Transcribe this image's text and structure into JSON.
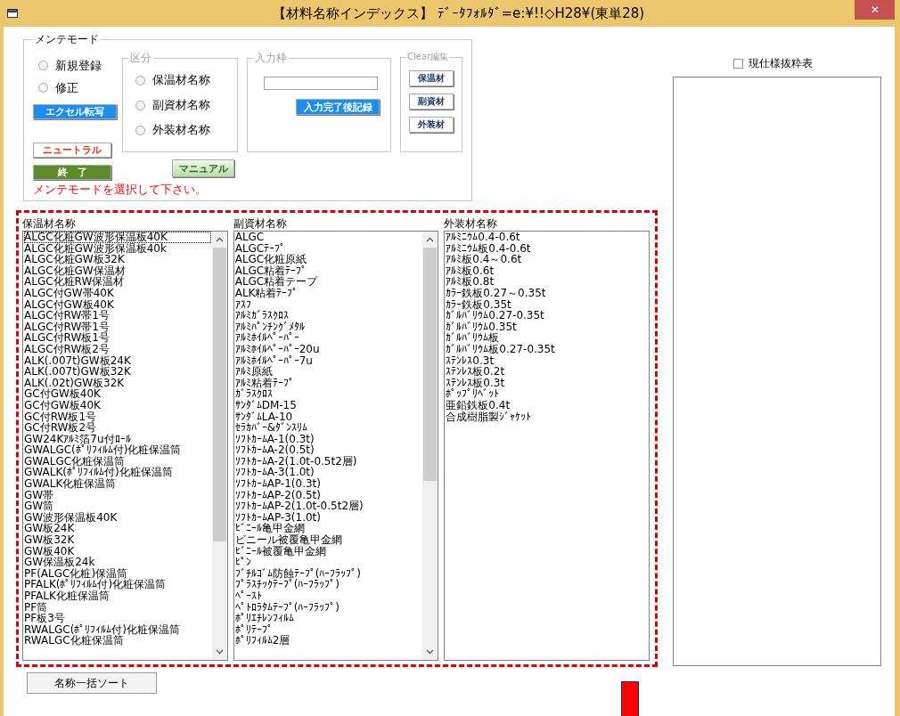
{
  "title_bar": {
    "title": "【材料名称インデックス】 ﾃﾞｰﾀﾌｫﾙﾀﾞ=e:¥!!◇H28¥(東単28)",
    "close": "✕"
  },
  "mode_group": {
    "legend": "メンテモード",
    "modes": [
      {
        "label": "新規登録",
        "checked": false
      },
      {
        "label": "修正",
        "checked": false
      }
    ],
    "excel_button": "エクセル転写",
    "neutral_button": "ニュートラル",
    "exit_button": "終　了",
    "manual_button": "マニュアル",
    "message": "メンテモードを選択して下さい。"
  },
  "category_group": {
    "legend": "区分",
    "disabled": true,
    "options": [
      {
        "label": "保温材名称",
        "checked": false
      },
      {
        "label": "副資材名称",
        "checked": false
      },
      {
        "label": "外装材名称",
        "checked": false
      }
    ]
  },
  "input_group": {
    "legend": "入力枠",
    "disabled": true,
    "record_button": "入力完了後記録"
  },
  "clear_group": {
    "legend": "Clear編集",
    "disabled": true,
    "buttons": [
      "保温材",
      "副資材",
      "外装材"
    ]
  },
  "lists": [
    {
      "heading": "保温材名称",
      "scrollbar": true,
      "items": [
        {
          "text": "ALGC化粧GW波形保温板40K",
          "focused": true
        },
        {
          "text": "ALGC化粧GW波形保温板40k",
          "focused": false
        },
        {
          "text": "ALGC化粧GW板32K",
          "focused": false
        },
        {
          "text": "ALGC化粧GW保温材",
          "focused": false
        },
        {
          "text": "ALGC化粧RW保温材",
          "focused": false
        },
        {
          "text": "ALGC付GW帯40K",
          "focused": false
        },
        {
          "text": "ALGC付GW板40K",
          "focused": false
        },
        {
          "text": "ALGC付RW帯1号",
          "focused": false
        },
        {
          "text": "ALGC付RW帯1号",
          "focused": false
        },
        {
          "text": "ALGC付RW板1号",
          "focused": false
        },
        {
          "text": "ALGC付RW板2号",
          "focused": false
        },
        {
          "text": "ALK(.007t)GW板24K",
          "focused": false
        },
        {
          "text": "ALK(.007t)GW板32K",
          "focused": false
        },
        {
          "text": "ALK(.02t)GW板32K",
          "focused": false
        },
        {
          "text": "GC付GW板40K",
          "focused": false
        },
        {
          "text": "GC付GW板40K",
          "focused": false
        },
        {
          "text": "GC付RW板1号",
          "focused": false
        },
        {
          "text": "GC付RW板2号",
          "focused": false
        },
        {
          "text": "GW24Kｱﾙﾐ箔7u付ﾛｰﾙ",
          "focused": false
        },
        {
          "text": "GWALGC(ﾎﾟﾘﾌｨﾙﾑ付)化粧保温筒",
          "focused": false
        },
        {
          "text": "GWALGC化粧保温筒",
          "focused": false
        },
        {
          "text": "GWALK(ﾎﾟﾘﾌｨﾙﾑ付)化粧保温筒",
          "focused": false
        },
        {
          "text": "GWALK化粧保温筒",
          "focused": false
        },
        {
          "text": "GW帯",
          "focused": false
        },
        {
          "text": "GW筒",
          "focused": false
        },
        {
          "text": "GW波形保温板40K",
          "focused": false
        },
        {
          "text": "GW板24K",
          "focused": false
        },
        {
          "text": "GW板32K",
          "focused": false
        },
        {
          "text": "GW板40K",
          "focused": false
        },
        {
          "text": "GW保温板24k",
          "focused": false
        },
        {
          "text": "PF(ALGC化粧)保温筒",
          "focused": false
        },
        {
          "text": "PFALK(ﾎﾟﾘﾌｨﾙﾑ付)化粧保温筒",
          "focused": false
        },
        {
          "text": "PFALK化粧保温筒",
          "focused": false
        },
        {
          "text": "PF筒",
          "focused": false
        },
        {
          "text": "PF板3号",
          "focused": false
        },
        {
          "text": "RWALGC(ﾎﾟﾘﾌｨﾙﾑ付)化粧保温筒",
          "focused": false
        },
        {
          "text": "RWALGC化粧保温筒",
          "focused": false
        }
      ]
    },
    {
      "heading": "副資材名称",
      "scrollbar": true,
      "items": [
        {
          "text": "ALGC",
          "focused": false
        },
        {
          "text": "ALGCﾃｰﾌﾟ",
          "focused": false
        },
        {
          "text": "ALGC化粧原紙",
          "focused": false
        },
        {
          "text": "ALGC粘着ﾃｰﾌﾟ",
          "focused": false
        },
        {
          "text": "ALGC粘着テープ",
          "focused": false
        },
        {
          "text": "ALK粘着ﾃｰﾌﾟ",
          "focused": false
        },
        {
          "text": "ｱｽﾌ",
          "focused": false
        },
        {
          "text": "ｱﾙﾐｶﾞﾗｽｸﾛｽ",
          "focused": false
        },
        {
          "text": "ｱﾙﾐﾊﾟﾝﾁﾝｸﾞﾒﾀﾙ",
          "focused": false
        },
        {
          "text": "ｱﾙﾐﾎｲﾙﾍﾟｰﾊﾟｰ",
          "focused": false
        },
        {
          "text": "ｱﾙﾐﾎｲﾙﾍﾟｰﾊﾟｰ20u",
          "focused": false
        },
        {
          "text": "ｱﾙﾐﾎｲﾙﾍﾟｰﾊﾟｰ7u",
          "focused": false
        },
        {
          "text": "ｱﾙﾐ原紙",
          "focused": false
        },
        {
          "text": "ｱﾙﾐ粘着ﾃｰﾌﾟ",
          "focused": false
        },
        {
          "text": "ｶﾞﾗｽｸﾛｽ",
          "focused": false
        },
        {
          "text": "ｻﾝﾀﾞﾑDM-15",
          "focused": false
        },
        {
          "text": "ｻﾝﾀﾞﾑLA-10",
          "focused": false
        },
        {
          "text": "ｾﾗｶﾊﾞｰ&ﾀﾞﾝｽﾘﾑ",
          "focused": false
        },
        {
          "text": "ｿﾌﾄｶｰﾑA-1(0.3t)",
          "focused": false
        },
        {
          "text": "ｿﾌﾄｶｰﾑA-2(0.5t)",
          "focused": false
        },
        {
          "text": "ｿﾌﾄｶｰﾑA-2(1.0t-0.5t2層)",
          "focused": false
        },
        {
          "text": "ｿﾌﾄｶｰﾑA-3(1.0t)",
          "focused": false
        },
        {
          "text": "ｿﾌﾄｶｰﾑAP-1(0.3t)",
          "focused": false
        },
        {
          "text": "ｿﾌﾄｶｰﾑAP-2(0.5t)",
          "focused": false
        },
        {
          "text": "ｿﾌﾄｶｰﾑAP-2(1.0t-0.5t2層)",
          "focused": false
        },
        {
          "text": "ｿﾌﾄｶｰﾑAP-3(1.0t)",
          "focused": false
        },
        {
          "text": "ﾋﾞﾆｰﾙ亀甲金網",
          "focused": false
        },
        {
          "text": "ビニール被覆亀甲金網",
          "focused": false
        },
        {
          "text": "ﾋﾞﾆｰﾙ被覆亀甲金網",
          "focused": false
        },
        {
          "text": "ﾋﾟﾝ",
          "focused": false
        },
        {
          "text": "ﾌﾞﾁﾙｺﾞﾑ防蝕ﾃｰﾌﾟ(ﾊｰﾌﾗｯﾌﾟ)",
          "focused": false
        },
        {
          "text": "ﾌﾟﾗｽﾁｯｸﾃｰﾌﾟ(ﾊｰﾌﾗｯﾌﾟ)",
          "focused": false
        },
        {
          "text": "ﾍﾟｰｽﾄ",
          "focused": false
        },
        {
          "text": "ﾍﾟﾄﾛﾗﾀﾑﾃｰﾌﾟ(ﾊｰﾌﾗｯﾌﾟ)",
          "focused": false
        },
        {
          "text": "ﾎﾟﾘｴﾁﾚﾝﾌｨﾙﾑ",
          "focused": false
        },
        {
          "text": "ﾎﾟﾘﾃｰﾌﾟ",
          "focused": false
        },
        {
          "text": "ﾎﾟﾘﾌｨﾙﾑ2層",
          "focused": false
        }
      ]
    },
    {
      "heading": "外装材名称",
      "scrollbar": false,
      "items": [
        {
          "text": "ｱﾙﾐﾆｳﾑ0.4-0.6t",
          "focused": false
        },
        {
          "text": "ｱﾙﾐﾆｳﾑ板0.4-0.6t",
          "focused": false
        },
        {
          "text": "ｱﾙﾐ板0.4～0.6t",
          "focused": false
        },
        {
          "text": "ｱﾙﾐ板0.6t",
          "focused": false
        },
        {
          "text": "ｱﾙﾐ板0.8t",
          "focused": false
        },
        {
          "text": "ｶﾗｰ鉄板0.27～0.35t",
          "focused": false
        },
        {
          "text": "ｶﾗｰ鉄板0.35t",
          "focused": false
        },
        {
          "text": "ｶﾞﾙﾊﾞﾘｳﾑ0.27-0.35t",
          "focused": false
        },
        {
          "text": "ｶﾞﾙﾊﾞﾘｳﾑ0.35t",
          "focused": false
        },
        {
          "text": "ｶﾞﾙﾊﾞﾘｳﾑ板",
          "focused": false
        },
        {
          "text": "ｶﾞﾙﾊﾞﾘｳﾑ板0.27-0.35t",
          "focused": false
        },
        {
          "text": "ｽﾃﾝﾚｽ0.3t",
          "focused": false
        },
        {
          "text": "ｽﾃﾝﾚｽ板0.2t",
          "focused": false
        },
        {
          "text": "ｽﾃﾝﾚｽ板0.3t",
          "focused": false
        },
        {
          "text": "ﾎﾟｯﾌﾟﾘﾍﾞｯﾄ",
          "focused": false
        },
        {
          "text": "亜鉛鉄板0.4t",
          "focused": false
        },
        {
          "text": "合成樹脂製ｼﾞｬｹｯﾄ",
          "focused": false
        }
      ]
    }
  ],
  "spec_checkbox": {
    "label": "現仕様抜粋表",
    "checked": false
  },
  "sort_button": "名称一括ソート"
}
